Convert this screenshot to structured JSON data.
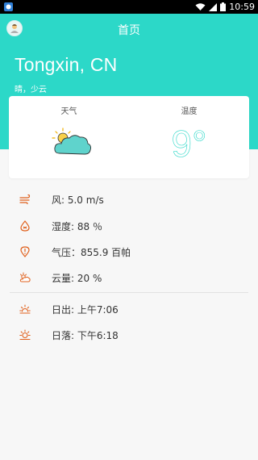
{
  "status_bar": {
    "time": "10:59"
  },
  "app_bar": {
    "title": "首页"
  },
  "location": {
    "city": "Tongxin, CN",
    "description": "晴，少云"
  },
  "card": {
    "weather_label": "天气",
    "weather_icon": "partly-cloudy-icon",
    "temperature_label": "温度",
    "temperature": "9°"
  },
  "details": {
    "wind": "风: 5.0 m/s",
    "humidity": "湿度: 88 ％",
    "pressure": "气压：855.9 百帕",
    "cloudiness": "云量: 20 %",
    "sunrise": "日出: 上午7:06",
    "sunset": "日落: 下午6:18"
  },
  "colors": {
    "accent": "#2cd8c8",
    "icon": "#e0601c"
  }
}
